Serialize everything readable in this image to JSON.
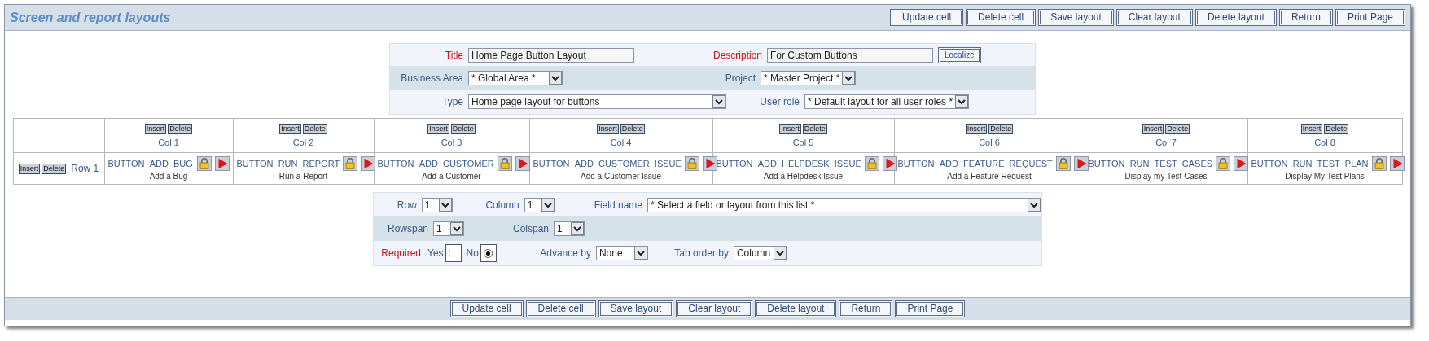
{
  "header": {
    "title": "Screen and report layouts"
  },
  "top_buttons": [
    "Update cell",
    "Delete cell",
    "Save layout",
    "Clear layout",
    "Delete layout",
    "Return",
    "Print Page"
  ],
  "form": {
    "title": {
      "label": "Title",
      "value": "Home Page Button Layout"
    },
    "description": {
      "label": "Description",
      "value": "For Custom Buttons"
    },
    "localize": "Localize",
    "business_area": {
      "label": "Business Area",
      "value": "* Global Area *"
    },
    "project": {
      "label": "Project",
      "value": "* Master Project *"
    },
    "type": {
      "label": "Type",
      "value": "Home page layout for buttons"
    },
    "user_role": {
      "label": "User role",
      "value": "* Default layout for all user roles *"
    }
  },
  "grid": {
    "row": {
      "insert": "Insert",
      "delete": "Delete",
      "label": "Row 1"
    },
    "columns": [
      {
        "insert": "Insert",
        "delete": "Delete",
        "label": "Col 1",
        "field": "BUTTON_ADD_BUG",
        "caption": "Add a Bug"
      },
      {
        "insert": "Insert",
        "delete": "Delete",
        "label": "Col 2",
        "field": "BUTTON_RUN_REPORT",
        "caption": "Run a Report"
      },
      {
        "insert": "Insert",
        "delete": "Delete",
        "label": "Col 3",
        "field": "BUTTON_ADD_CUSTOMER",
        "caption": "Add a Customer"
      },
      {
        "insert": "Insert",
        "delete": "Delete",
        "label": "Col 4",
        "field": "BUTTON_ADD_CUSTOMER_ISSUE",
        "caption": "Add a Customer Issue"
      },
      {
        "insert": "Insert",
        "delete": "Delete",
        "label": "Col 5",
        "field": "BUTTON_ADD_HELPDESK_ISSUE",
        "caption": "Add a Helpdesk Issue"
      },
      {
        "insert": "Insert",
        "delete": "Delete",
        "label": "Col 6",
        "field": "BUTTON_ADD_FEATURE_REQUEST",
        "caption": "Add a Feature Request"
      },
      {
        "insert": "Insert",
        "delete": "Delete",
        "label": "Col 7",
        "field": "BUTTON_RUN_TEST_CASES",
        "caption": "Display my Test Cases"
      },
      {
        "insert": "Insert",
        "delete": "Delete",
        "label": "Col 8",
        "field": "BUTTON_RUN_TEST_PLAN",
        "caption": "Display My Test Plans"
      }
    ]
  },
  "cell_form": {
    "row": {
      "label": "Row",
      "value": "1"
    },
    "column": {
      "label": "Column",
      "value": "1"
    },
    "field_name": {
      "label": "Field name",
      "value": "* Select a field or layout from this list *"
    },
    "rowspan": {
      "label": "Rowspan",
      "value": "1"
    },
    "colspan": {
      "label": "Colspan",
      "value": "1"
    },
    "required": {
      "label": "Required",
      "options": [
        {
          "label": "Yes",
          "selected": false
        },
        {
          "label": "No",
          "selected": true
        }
      ]
    },
    "advance_by": {
      "label": "Advance by",
      "value": "None"
    },
    "tab_order_by": {
      "label": "Tab order by",
      "value": "Column"
    }
  },
  "bottom_buttons": [
    "Update cell",
    "Delete cell",
    "Save layout",
    "Clear layout",
    "Delete layout",
    "Return",
    "Print Page"
  ]
}
